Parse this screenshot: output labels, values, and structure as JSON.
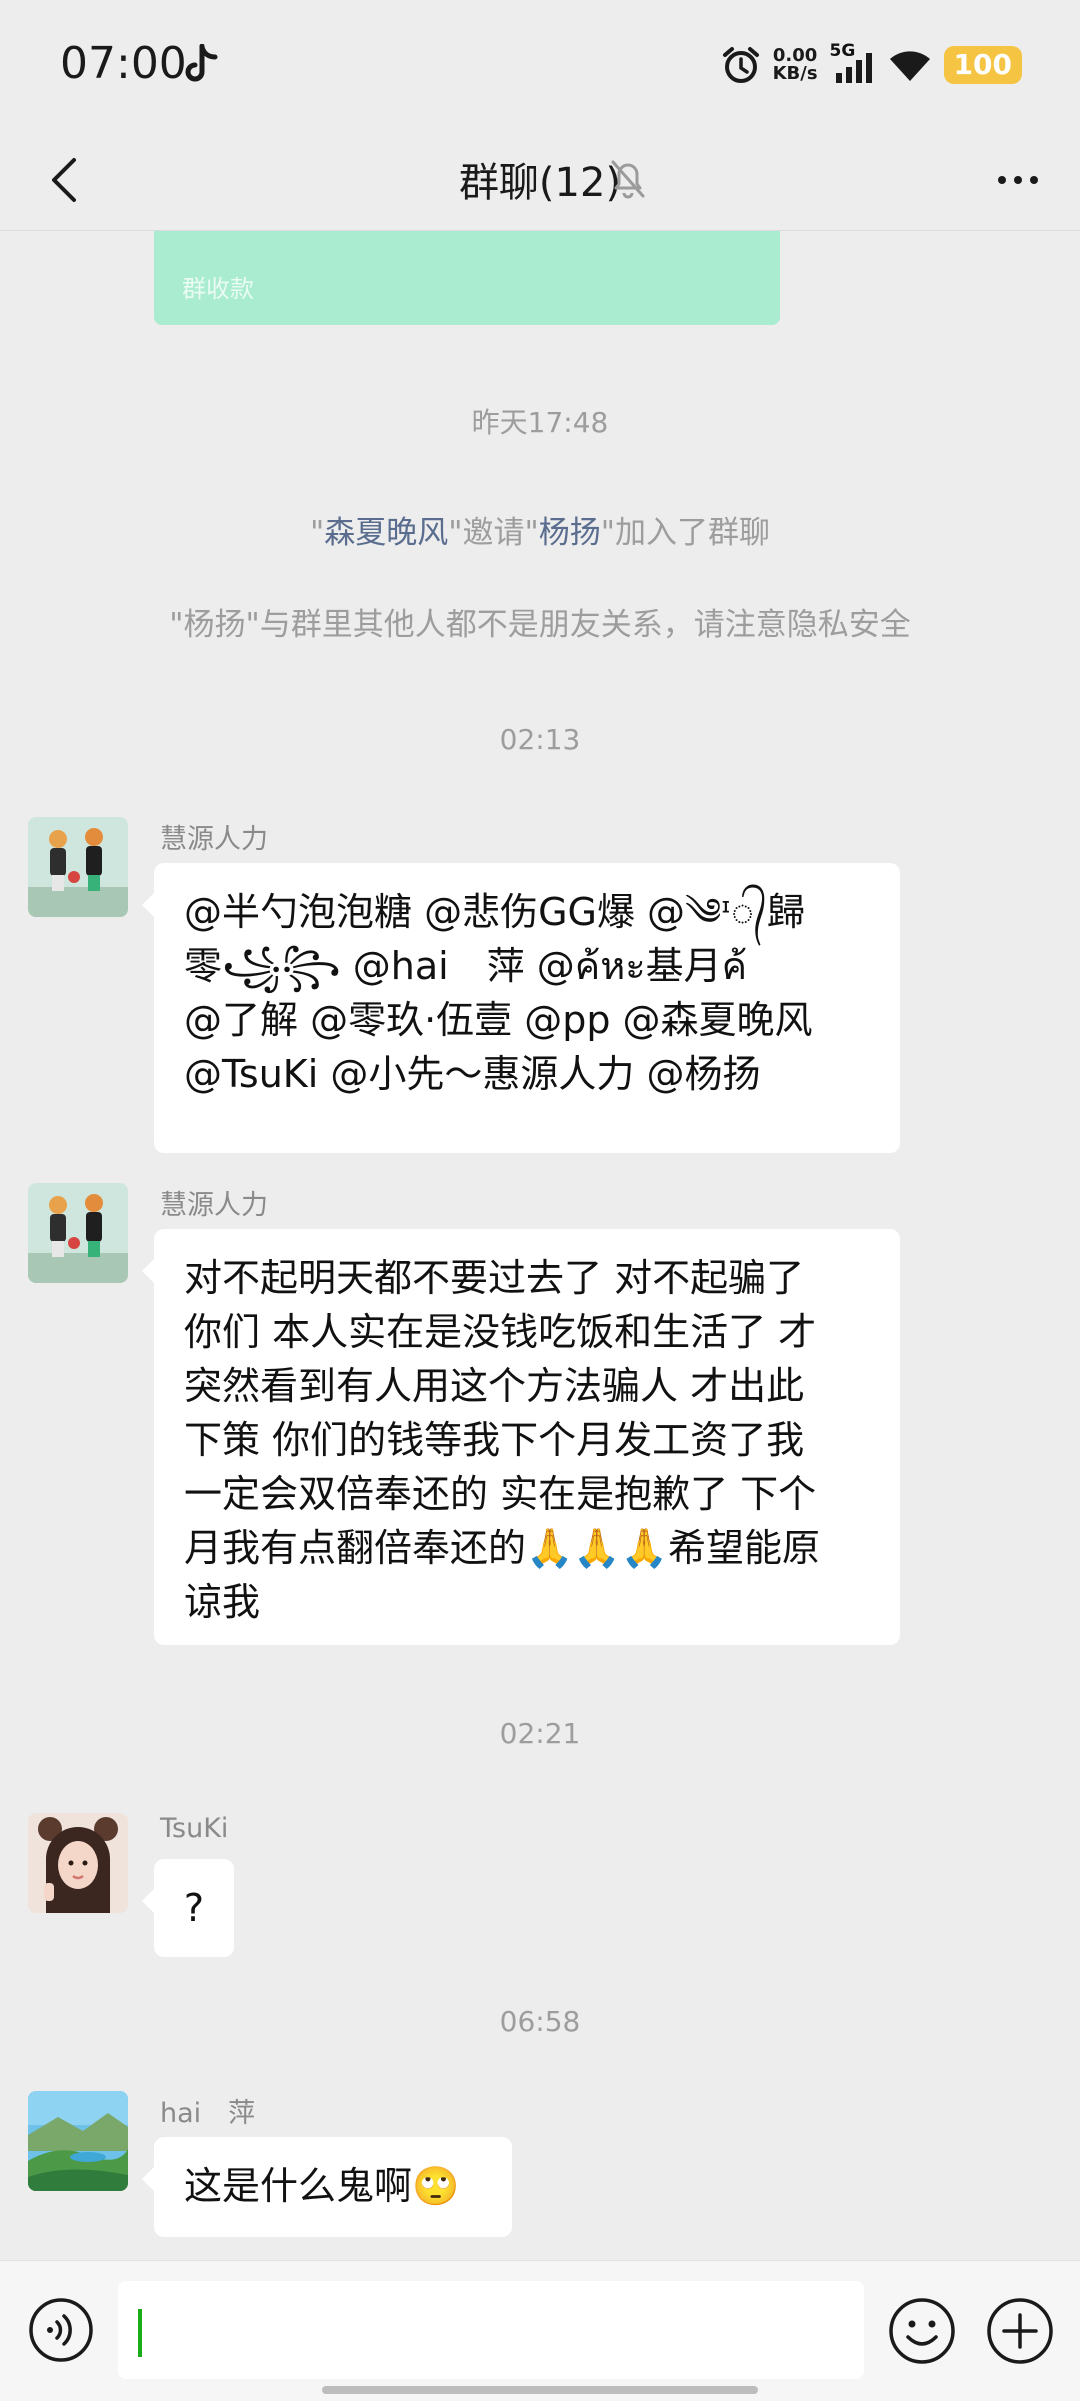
{
  "status_bar": {
    "time": "07:00",
    "net_speed_value": "0.00",
    "net_speed_unit": "KB/s",
    "network": "5G",
    "battery": "100"
  },
  "nav": {
    "title": "群聊(12)"
  },
  "pay_card": {
    "label": "群收款"
  },
  "system": {
    "time_1": "昨天17:48",
    "invite": {
      "q1": "\"",
      "inviter": "森夏晚风",
      "mid": "\"邀请\"",
      "invitee": "杨扬",
      "end": "\"加入了群聊"
    },
    "privacy_notice": "\"杨扬\"与群里其他人都不是朋友关系，请注意隐私安全",
    "time_2": "02:13",
    "time_3": "02:21",
    "time_4": "06:58"
  },
  "messages": [
    {
      "sender": "慧源人力",
      "lines": [
        "@半勺泡泡糖 @悲伤GG爆 @༄ᶦ᭄歸",
        "零꧁꧂ @hai　萍 @ค้หะ基月ค้",
        "@了解 @零玖·伍壹 @pp @森夏晚风",
        "@TsuKi @小先～惠源人力 @杨扬"
      ]
    },
    {
      "sender": "慧源人力",
      "lines": [
        "对不起明天都不要过去了 对不起骗了",
        "你们 本人实在是没钱吃饭和生活了 才",
        "突然看到有人用这个方法骗人 才出此",
        "下策 你们的钱等我下个月发工资了我",
        "一定会双倍奉还的 实在是抱歉了 下个",
        "月我有点翻倍奉还的🙏🙏🙏希望能原",
        "谅我"
      ]
    },
    {
      "sender": "TsuKi",
      "lines": [
        "?"
      ]
    },
    {
      "sender": "hai　萍",
      "lines": [
        "这是什么鬼啊🙄"
      ]
    }
  ],
  "icons": {
    "back": "chevron-left-icon",
    "mute": "bell-off-icon",
    "more": "more-dots-icon",
    "voice": "voice-icon",
    "emoji": "emoji-icon",
    "plus": "plus-icon"
  },
  "colors": {
    "chat_bg": "#ededed",
    "bubble": "#ffffff",
    "pay_card": "#a9ecd0",
    "battery": "#f6c443",
    "link": "#5a6d8f"
  }
}
